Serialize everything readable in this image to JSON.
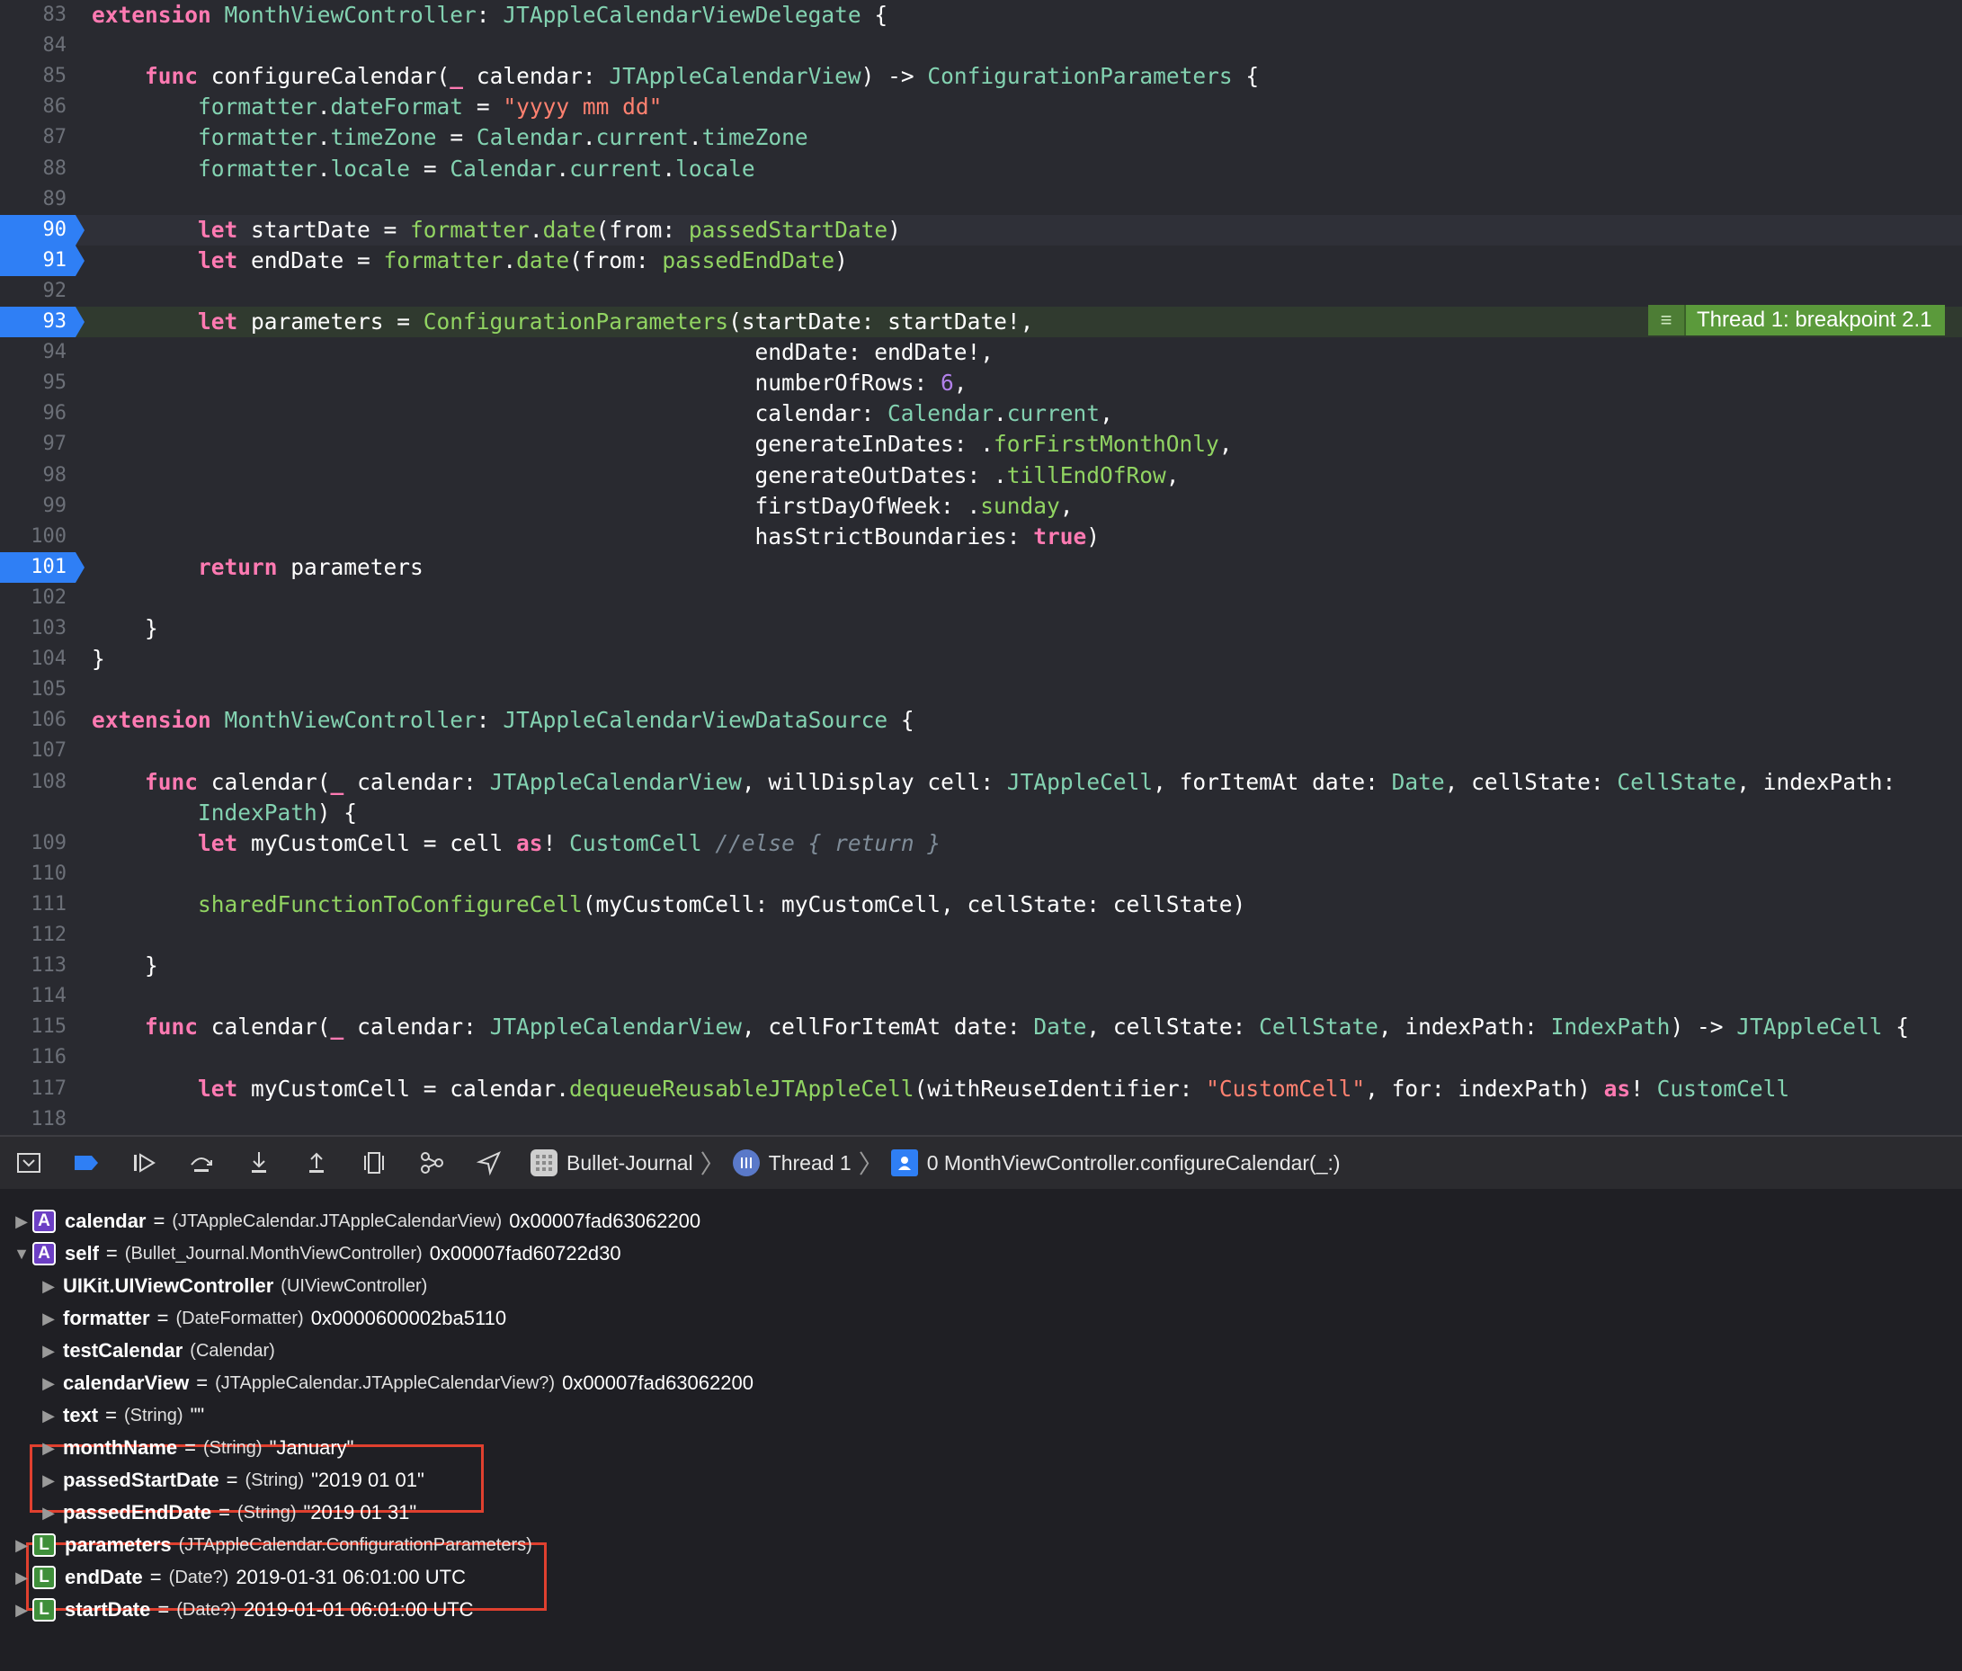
{
  "editor": {
    "lines": [
      {
        "n": "83",
        "html": "<span class=\"kw\">extension</span> <span class=\"ty\">MonthViewController</span>: <span class=\"ty\">JTAppleCalendarViewDelegate</span> {"
      },
      {
        "n": "84",
        "html": ""
      },
      {
        "n": "85",
        "html": "    <span class=\"kw\">func</span> configureCalendar(<span class=\"kw\">_</span> calendar: <span class=\"ty\">JTAppleCalendarView</span>) -> <span class=\"ty\">ConfigurationParameters</span> {"
      },
      {
        "n": "86",
        "html": "        <span class=\"ty\">formatter</span>.<span class=\"ty\">dateFormat</span> = <span class=\"st\">\"yyyy mm dd\"</span>"
      },
      {
        "n": "87",
        "html": "        <span class=\"ty\">formatter</span>.<span class=\"ty\">timeZone</span> = <span class=\"ty\">Calendar</span>.<span class=\"ty\">current</span>.<span class=\"ty\">timeZone</span>"
      },
      {
        "n": "88",
        "html": "        <span class=\"ty\">formatter</span>.<span class=\"ty\">locale</span> = <span class=\"ty\">Calendar</span>.<span class=\"ty\">current</span>.<span class=\"ty\">locale</span>"
      },
      {
        "n": "89",
        "html": ""
      },
      {
        "n": "90",
        "bp": true,
        "hl": "hl",
        "html": "        <span class=\"kw\">let</span> startDate = <span class=\"fn\">formatter</span>.<span class=\"fn\">date</span>(from: <span class=\"fn\">passedStartDate</span>)"
      },
      {
        "n": "91",
        "bp": true,
        "html": "        <span class=\"kw\">let</span> endDate = <span class=\"fn\">formatter</span>.<span class=\"fn\">date</span>(from: <span class=\"fn\">passedEndDate</span>)"
      },
      {
        "n": "92",
        "html": ""
      },
      {
        "n": "93",
        "bp": true,
        "hl": "cur",
        "html": "        <span class=\"kw\">let</span> parameters = <span class=\"fn\">ConfigurationParameters</span>(startDate: startDate!,"
      },
      {
        "n": "94",
        "html": "                                                  endDate: endDate!,"
      },
      {
        "n": "95",
        "html": "                                                  numberOfRows: <span class=\"pr\">6</span>,"
      },
      {
        "n": "96",
        "html": "                                                  calendar: <span class=\"ty\">Calendar</span>.<span class=\"ty\">current</span>,"
      },
      {
        "n": "97",
        "html": "                                                  generateInDates: .<span class=\"fn\">forFirstMonthOnly</span>,"
      },
      {
        "n": "98",
        "html": "                                                  generateOutDates: .<span class=\"fn\">tillEndOfRow</span>,"
      },
      {
        "n": "99",
        "html": "                                                  firstDayOfWeek: .<span class=\"fn\">sunday</span>,"
      },
      {
        "n": "100",
        "html": "                                                  hasStrictBoundaries: <span class=\"kw\">true</span>)"
      },
      {
        "n": "101",
        "bp": true,
        "html": "        <span class=\"kw\">return</span> parameters"
      },
      {
        "n": "102",
        "html": ""
      },
      {
        "n": "103",
        "html": "    }"
      },
      {
        "n": "104",
        "html": "}"
      },
      {
        "n": "105",
        "html": ""
      },
      {
        "n": "106",
        "html": "<span class=\"kw\">extension</span> <span class=\"ty\">MonthViewController</span>: <span class=\"ty\">JTAppleCalendarViewDataSource</span> {"
      },
      {
        "n": "107",
        "html": ""
      },
      {
        "n": "108",
        "html": "    <span class=\"kw\">func</span> calendar(<span class=\"kw\">_</span> calendar: <span class=\"ty\">JTAppleCalendarView</span>, willDisplay cell: <span class=\"ty\">JTAppleCell</span>, forItemAt date: <span class=\"ty\">Date</span>, cellState: <span class=\"ty\">CellState</span>, indexPath:"
      },
      {
        "n": "",
        "html": "        <span class=\"ty\">IndexPath</span>) {"
      },
      {
        "n": "109",
        "html": "        <span class=\"kw\">let</span> myCustomCell = cell <span class=\"kw\">as</span>! <span class=\"ty\">CustomCell</span> <span class=\"cm\">//else { return }</span>"
      },
      {
        "n": "110",
        "html": ""
      },
      {
        "n": "111",
        "html": "        <span class=\"fn\">sharedFunctionToConfigureCell</span>(myCustomCell: myCustomCell, cellState: cellState)"
      },
      {
        "n": "112",
        "html": ""
      },
      {
        "n": "113",
        "html": "    }"
      },
      {
        "n": "114",
        "html": ""
      },
      {
        "n": "115",
        "html": "    <span class=\"kw\">func</span> calendar(<span class=\"kw\">_</span> calendar: <span class=\"ty\">JTAppleCalendarView</span>, cellForItemAt date: <span class=\"ty\">Date</span>, cellState: <span class=\"ty\">CellState</span>, indexPath: <span class=\"ty\">IndexPath</span>) -> <span class=\"ty\">JTAppleCell</span> {"
      },
      {
        "n": "116",
        "html": ""
      },
      {
        "n": "117",
        "html": "        <span class=\"kw\">let</span> myCustomCell = calendar.<span class=\"fn\">dequeueReusableJTAppleCell</span>(withReuseIdentifier: <span class=\"st\">\"CustomCell\"</span>, for: indexPath) <span class=\"kw\">as</span>! <span class=\"ty\">CustomCell</span>"
      },
      {
        "n": "118",
        "html": ""
      }
    ],
    "breakpoint_annotation": "Thread 1: breakpoint 2.1",
    "breakpoint_annotation_icon": "list-icon"
  },
  "toolbar": {
    "icons": [
      "hide-debug-area-icon",
      "breakpoints-toggle-icon",
      "continue-icon",
      "step-over-icon",
      "step-into-icon",
      "step-out-icon",
      "view-hierarchy-icon",
      "memory-graph-icon",
      "simulate-location-icon"
    ],
    "breadcrumb": [
      "Bullet-Journal",
      "Thread 1",
      "0 MonthViewController.configureCalendar(_:)"
    ]
  },
  "variables": [
    {
      "badge": "A",
      "expanded": false,
      "name": "calendar",
      "eq": "=",
      "type": "(JTAppleCalendar.JTAppleCalendarView)",
      "value": "0x00007fad63062200"
    },
    {
      "badge": "A",
      "expanded": true,
      "name": "self",
      "eq": "=",
      "type": "(Bullet_Journal.MonthViewController)",
      "value": "0x00007fad60722d30"
    },
    {
      "badge": "",
      "expanded": false,
      "indent": true,
      "name": "UIKit.UIViewController",
      "eq": "",
      "type": "(UIViewController)",
      "value": ""
    },
    {
      "badge": "",
      "expanded": false,
      "indent": true,
      "name": "formatter",
      "eq": "=",
      "type": "(DateFormatter)",
      "value": "0x0000600002ba5110"
    },
    {
      "badge": "",
      "expanded": false,
      "indent": true,
      "name": "testCalendar",
      "eq": "",
      "type": "(Calendar)",
      "value": ""
    },
    {
      "badge": "",
      "expanded": false,
      "indent": true,
      "name": "calendarView",
      "eq": "=",
      "type": "(JTAppleCalendar.JTAppleCalendarView?)",
      "value": "0x00007fad63062200"
    },
    {
      "badge": "",
      "expanded": false,
      "indent": true,
      "name": "text",
      "eq": "=",
      "type": "(String)",
      "value": "\"\""
    },
    {
      "badge": "",
      "expanded": false,
      "indent": true,
      "name": "monthName",
      "eq": "=",
      "type": "(String)",
      "value": "\"January\""
    },
    {
      "badge": "",
      "expanded": false,
      "indent": true,
      "name": "passedStartDate",
      "eq": "=",
      "type": "(String)",
      "value": "\"2019 01 01\""
    },
    {
      "badge": "",
      "expanded": false,
      "indent": true,
      "name": "passedEndDate",
      "eq": "=",
      "type": "(String)",
      "value": "\"2019 01 31\""
    },
    {
      "badge": "L",
      "expanded": false,
      "name": "parameters",
      "eq": "",
      "type": "(JTAppleCalendar.ConfigurationParameters)",
      "value": ""
    },
    {
      "badge": "L",
      "expanded": false,
      "name": "endDate",
      "eq": "=",
      "type": "(Date?)",
      "value": "2019-01-31 06:01:00 UTC"
    },
    {
      "badge": "L",
      "expanded": false,
      "name": "startDate",
      "eq": "=",
      "type": "(Date?)",
      "value": "2019-01-01 06:01:00 UTC"
    }
  ],
  "colors": {
    "editor_bg": "#292a30",
    "breakpoint": "#2f7ff5",
    "current_line": "#303a2f",
    "annotation": "#5b9a3b",
    "highlight_box": "#e0402f"
  }
}
